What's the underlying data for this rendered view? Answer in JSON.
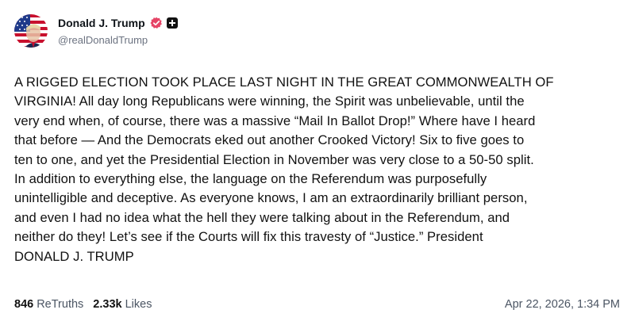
{
  "author": {
    "display_name": "Donald J. Trump",
    "handle": "@realDonaldTrump",
    "verified_icon": "verified-badge-icon",
    "badge_icon": "plus-badge-icon",
    "verified_color": "#e64567"
  },
  "post": {
    "lines": [
      "A RIGGED ELECTION TOOK PLACE LAST NIGHT IN THE GREAT COMMONWEALTH OF",
      "VIRGINIA! All day long Republicans were winning, the Spirit was unbelievable, until the",
      "very end when, of course, there was a massive “Mail In Ballot Drop!” Where have I heard",
      "that before — And the Democrats eked out another Crooked Victory! Six to five goes to",
      "ten to one, and yet the Presidential Election in November was very close to a 50-50 split.",
      "In addition to everything else, the language on the Referendum was purposefully",
      "unintelligible and deceptive. As everyone knows, I am an extraordinarily brilliant person,",
      "and even I had no idea what the hell they were talking about in the Referendum, and",
      "neither do they! Let’s see if the Courts will fix this travesty of “Justice.” President",
      "DONALD J. TRUMP"
    ]
  },
  "stats": {
    "retruths_count": "846",
    "retruths_label": "ReTruths",
    "likes_count": "2.33k",
    "likes_label": "Likes"
  },
  "timestamp": "Apr 22, 2026, 1:34 PM"
}
